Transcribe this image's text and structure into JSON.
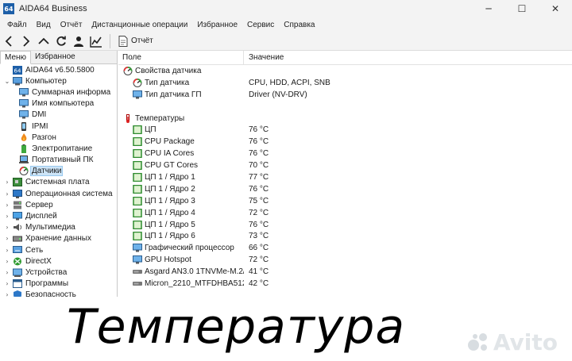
{
  "window": {
    "title": "AIDA64 Business",
    "app_icon": "64",
    "controls": [
      "─",
      "☐",
      "✕"
    ]
  },
  "menu": [
    "Файл",
    "Вид",
    "Отчёт",
    "Дистанционные операции",
    "Избранное",
    "Сервис",
    "Справка"
  ],
  "toolbar": {
    "report_label": "Отчёт"
  },
  "left_panel": {
    "tabs": [
      "Меню",
      "Избранное"
    ],
    "tree": [
      {
        "label": "AIDA64 v6.50.5800",
        "level": 0,
        "expander": "",
        "icon": "aida-icon"
      },
      {
        "label": "Компьютер",
        "level": 0,
        "expander": "⌄",
        "icon": "computer-icon"
      },
      {
        "label": "Суммарная информа",
        "level": 1,
        "expander": "",
        "icon": "monitor-icon"
      },
      {
        "label": "Имя компьютера",
        "level": 1,
        "expander": "",
        "icon": "monitor-icon"
      },
      {
        "label": "DMI",
        "level": 1,
        "expander": "",
        "icon": "monitor-icon"
      },
      {
        "label": "IPMI",
        "level": 1,
        "expander": "",
        "icon": "phone-icon"
      },
      {
        "label": "Разгон",
        "level": 1,
        "expander": "",
        "icon": "flame-icon"
      },
      {
        "label": "Электропитание",
        "level": 1,
        "expander": "",
        "icon": "battery-icon"
      },
      {
        "label": "Портативный ПК",
        "level": 1,
        "expander": "",
        "icon": "laptop-icon"
      },
      {
        "label": "Датчики",
        "level": 1,
        "expander": "",
        "icon": "gauge-icon",
        "selected": true
      },
      {
        "label": "Системная плата",
        "level": 0,
        "expander": "›",
        "icon": "board-icon"
      },
      {
        "label": "Операционная система",
        "level": 0,
        "expander": "›",
        "icon": "os-icon"
      },
      {
        "label": "Сервер",
        "level": 0,
        "expander": "›",
        "icon": "server-icon"
      },
      {
        "label": "Дисплей",
        "level": 0,
        "expander": "›",
        "icon": "display-icon"
      },
      {
        "label": "Мультимедиа",
        "level": 0,
        "expander": "›",
        "icon": "multimedia-icon"
      },
      {
        "label": "Хранение данных",
        "level": 0,
        "expander": "›",
        "icon": "storage-icon"
      },
      {
        "label": "Сеть",
        "level": 0,
        "expander": "›",
        "icon": "network-icon"
      },
      {
        "label": "DirectX",
        "level": 0,
        "expander": "›",
        "icon": "directx-icon"
      },
      {
        "label": "Устройства",
        "level": 0,
        "expander": "›",
        "icon": "devices-icon"
      },
      {
        "label": "Программы",
        "level": 0,
        "expander": "›",
        "icon": "programs-icon"
      },
      {
        "label": "Безопасность",
        "level": 0,
        "expander": "›",
        "icon": "security-icon"
      }
    ]
  },
  "right_panel": {
    "columns": [
      "Поле",
      "Значение"
    ],
    "rows": [
      {
        "kind": "group",
        "field": "Свойства датчика",
        "value": "",
        "icon": "gauge-icon"
      },
      {
        "kind": "item",
        "field": "Тип датчика",
        "value": "CPU, HDD, ACPI, SNB",
        "icon": "gauge-icon"
      },
      {
        "kind": "item",
        "field": "Тип датчика ГП",
        "value": "Driver  (NV-DRV)",
        "icon": "monitor-icon"
      },
      {
        "kind": "blank",
        "field": "",
        "value": "",
        "icon": ""
      },
      {
        "kind": "group",
        "field": "Температуры",
        "value": "",
        "icon": "thermometer-icon"
      },
      {
        "kind": "item",
        "field": "ЦП",
        "value": "76 °C",
        "icon": "chip-icon"
      },
      {
        "kind": "item",
        "field": "CPU Package",
        "value": "76 °C",
        "icon": "chip-icon"
      },
      {
        "kind": "item",
        "field": "CPU IA Cores",
        "value": "76 °C",
        "icon": "chip-icon"
      },
      {
        "kind": "item",
        "field": "CPU GT Cores",
        "value": "70 °C",
        "icon": "chip-icon"
      },
      {
        "kind": "item",
        "field": "ЦП 1 / Ядро 1",
        "value": "77 °C",
        "icon": "chip-icon"
      },
      {
        "kind": "item",
        "field": "ЦП 1 / Ядро 2",
        "value": "76 °C",
        "icon": "chip-icon"
      },
      {
        "kind": "item",
        "field": "ЦП 1 / Ядро 3",
        "value": "75 °C",
        "icon": "chip-icon"
      },
      {
        "kind": "item",
        "field": "ЦП 1 / Ядро 4",
        "value": "72 °C",
        "icon": "chip-icon"
      },
      {
        "kind": "item",
        "field": "ЦП 1 / Ядро 5",
        "value": "76 °C",
        "icon": "chip-icon"
      },
      {
        "kind": "item",
        "field": "ЦП 1 / Ядро 6",
        "value": "73 °C",
        "icon": "chip-icon"
      },
      {
        "kind": "item",
        "field": "Графический процессор",
        "value": "66 °C",
        "icon": "monitor-icon"
      },
      {
        "kind": "item",
        "field": "GPU Hotspot",
        "value": "72 °C",
        "icon": "monitor-icon"
      },
      {
        "kind": "item",
        "field": "Asgard AN3.0 1TNVMe-M.2/...",
        "value": "41 °C",
        "icon": "disk-icon"
      },
      {
        "kind": "item",
        "field": "Micron_2210_MTFDHBA512...",
        "value": "42 °C",
        "icon": "disk-icon"
      }
    ]
  },
  "overlay": {
    "caption": "Температура",
    "watermark": "Avito"
  },
  "colors": {
    "selection": "#cce4f7",
    "chip_green": "#2e8b2e",
    "accent_blue": "#1d5fa8"
  }
}
